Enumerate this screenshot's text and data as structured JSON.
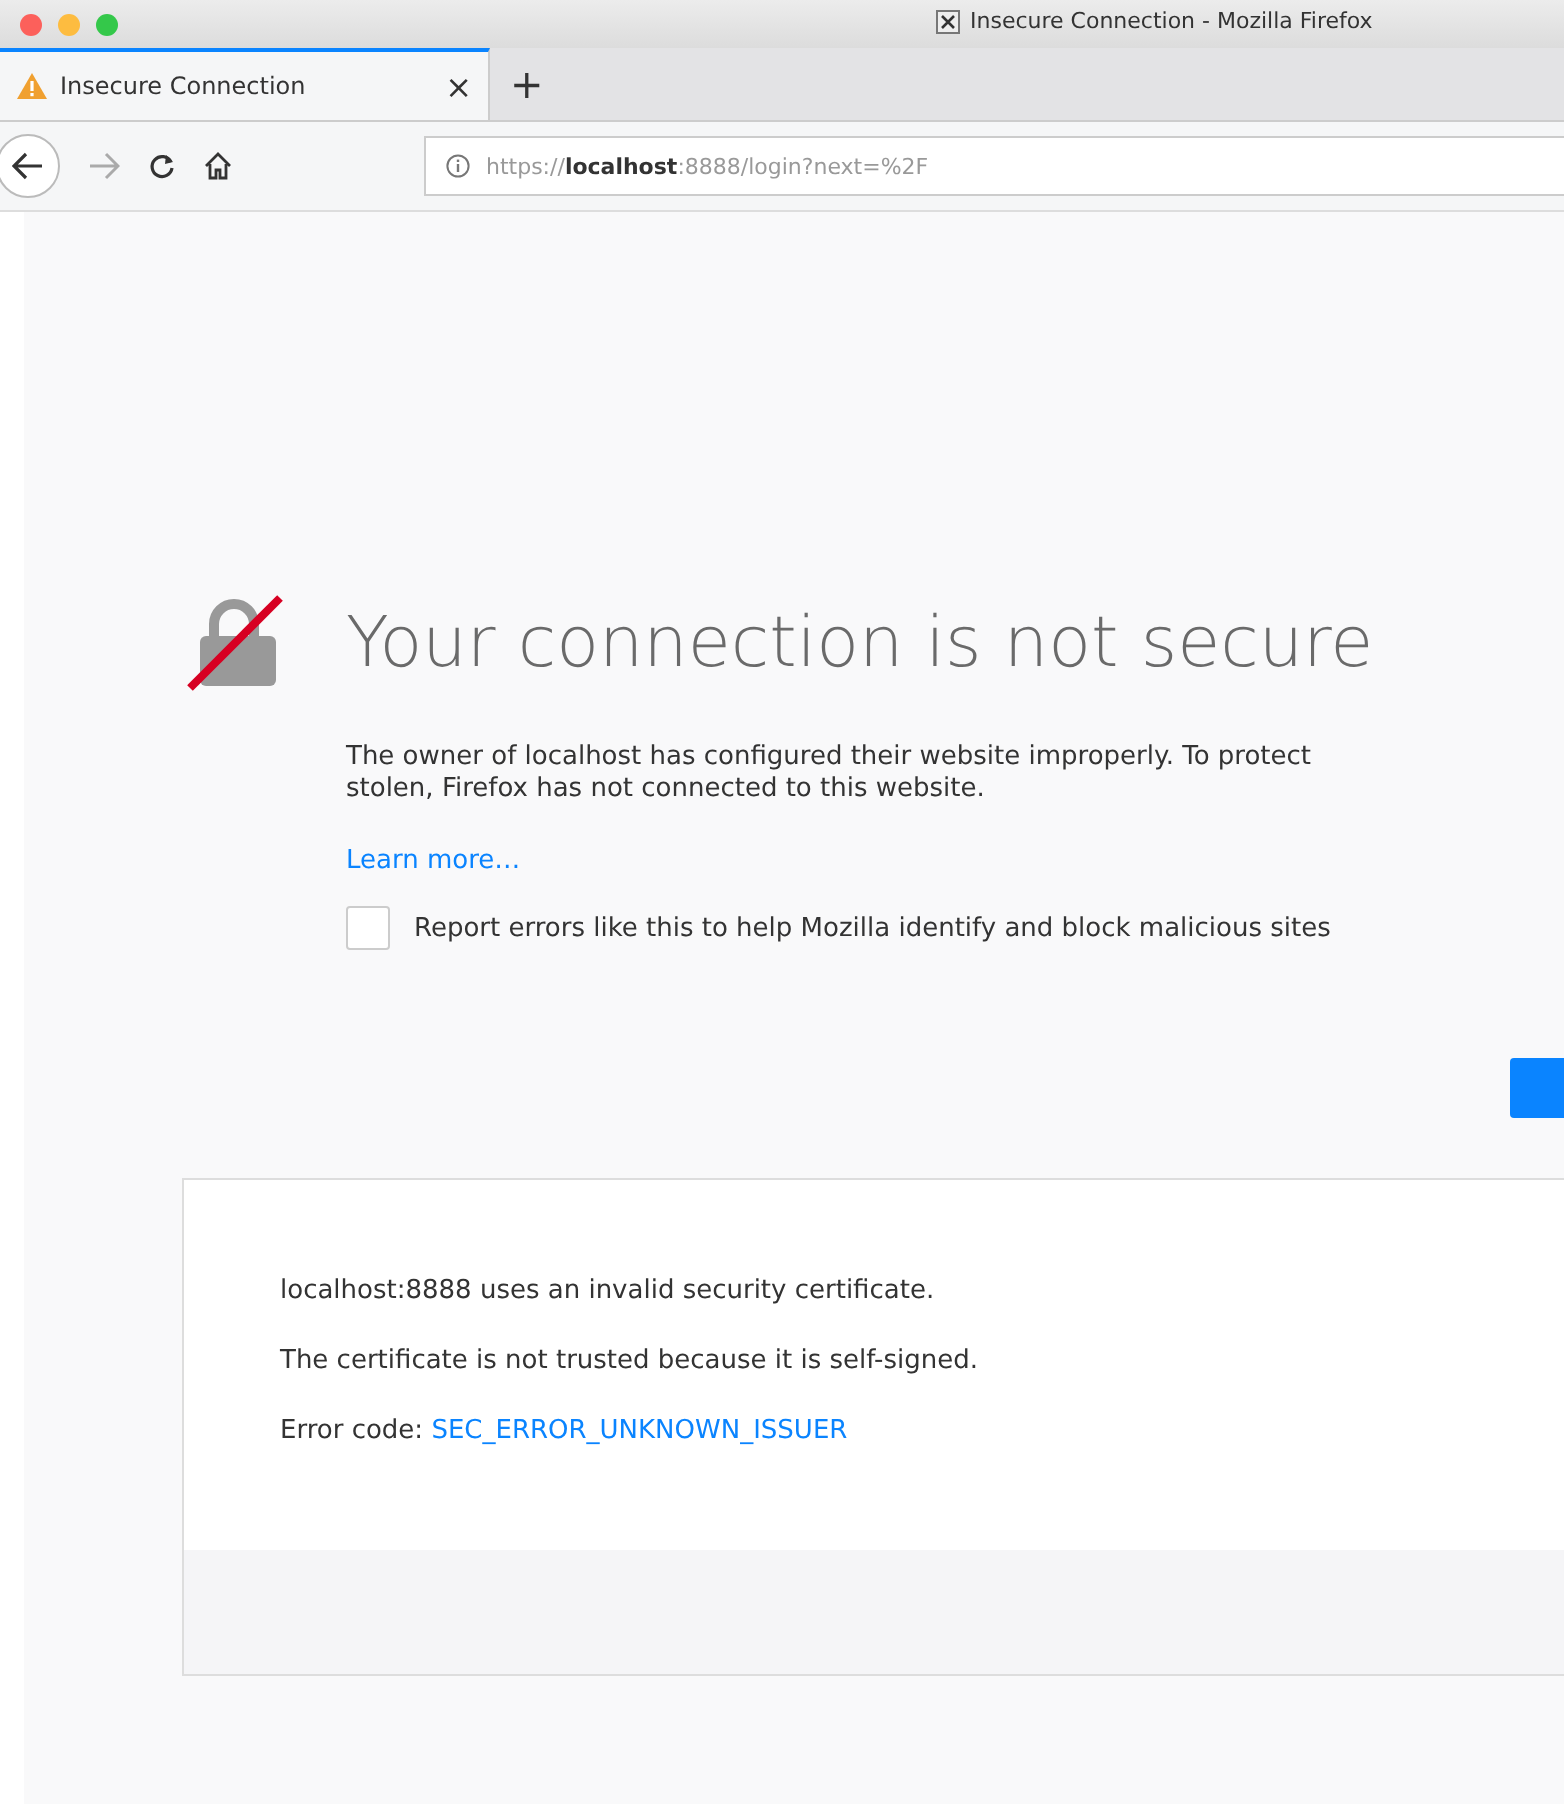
{
  "window": {
    "title": "Insecure Connection - Mozilla Firefox"
  },
  "tabs": [
    {
      "label": "Insecure Connection",
      "close": "×",
      "selected": true
    }
  ],
  "new_tab": "+",
  "address_bar": {
    "scheme": "https://",
    "host": "localhost",
    "rest": ":8888/login?next=%2F"
  },
  "error": {
    "heading": "Your connection is not secure",
    "lines": [
      "The owner of localhost has configured their website improperly. To protect",
      "stolen, Firefox has not connected to this website."
    ],
    "learn_more": "Learn more…",
    "report": {
      "label": "Report errors like this to help Mozilla identify and block malicious sites",
      "checked": false
    },
    "details": [
      "localhost:8888 uses an invalid security certificate.",
      "The certificate is not trusted because it is self-signed."
    ],
    "error_code_label": "Error code:",
    "error_code": "SEC_ERROR_UNKNOWN_ISSUER"
  }
}
